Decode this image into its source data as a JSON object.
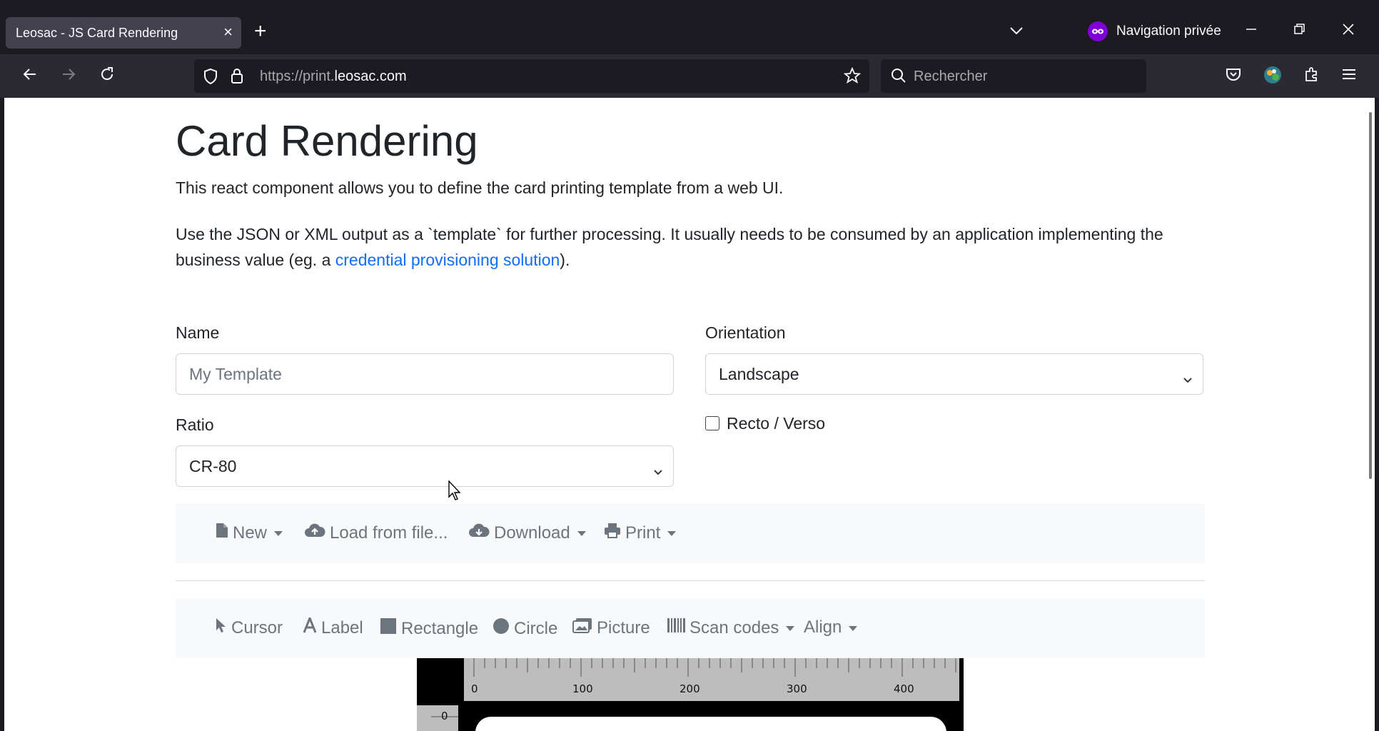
{
  "browser": {
    "tab_title": "Leosac - JS Card Rendering",
    "private_label": "Navigation privée",
    "url_prefix": "https://print.",
    "url_host": "leosac.com",
    "search_placeholder": "Rechercher"
  },
  "page": {
    "title": "Card Rendering",
    "lead1": "This react component allows you to define the card printing template from a web UI.",
    "lead2_text": "Use the JSON or XML output as a `template` for further processing. It usually needs to be consumed by an application implementing the business value (eg. a ",
    "lead2_link": "credential provisioning solution",
    "lead2_end": ").",
    "form": {
      "name_label": "Name",
      "name_placeholder": "My Template",
      "orientation_label": "Orientation",
      "orientation_value": "Landscape",
      "ratio_label": "Ratio",
      "ratio_value": "CR-80",
      "recto_verso_label": "Recto / Verso"
    },
    "file_toolbar": {
      "new": "New",
      "load": "Load from file...",
      "download": "Download",
      "print": "Print"
    },
    "tools_toolbar": {
      "cursor": "Cursor",
      "label": "Label",
      "rectangle": "Rectangle",
      "circle": "Circle",
      "picture": "Picture",
      "scan_codes": "Scan codes",
      "align": "Align"
    },
    "ruler": {
      "h_ticks": [
        "0",
        "100",
        "200",
        "300",
        "400"
      ],
      "v_tick": "0"
    }
  },
  "colors": {
    "link": "#0d6efd",
    "private_accent": "#8000d7",
    "toolbar_bg": "#f8f9fa"
  }
}
